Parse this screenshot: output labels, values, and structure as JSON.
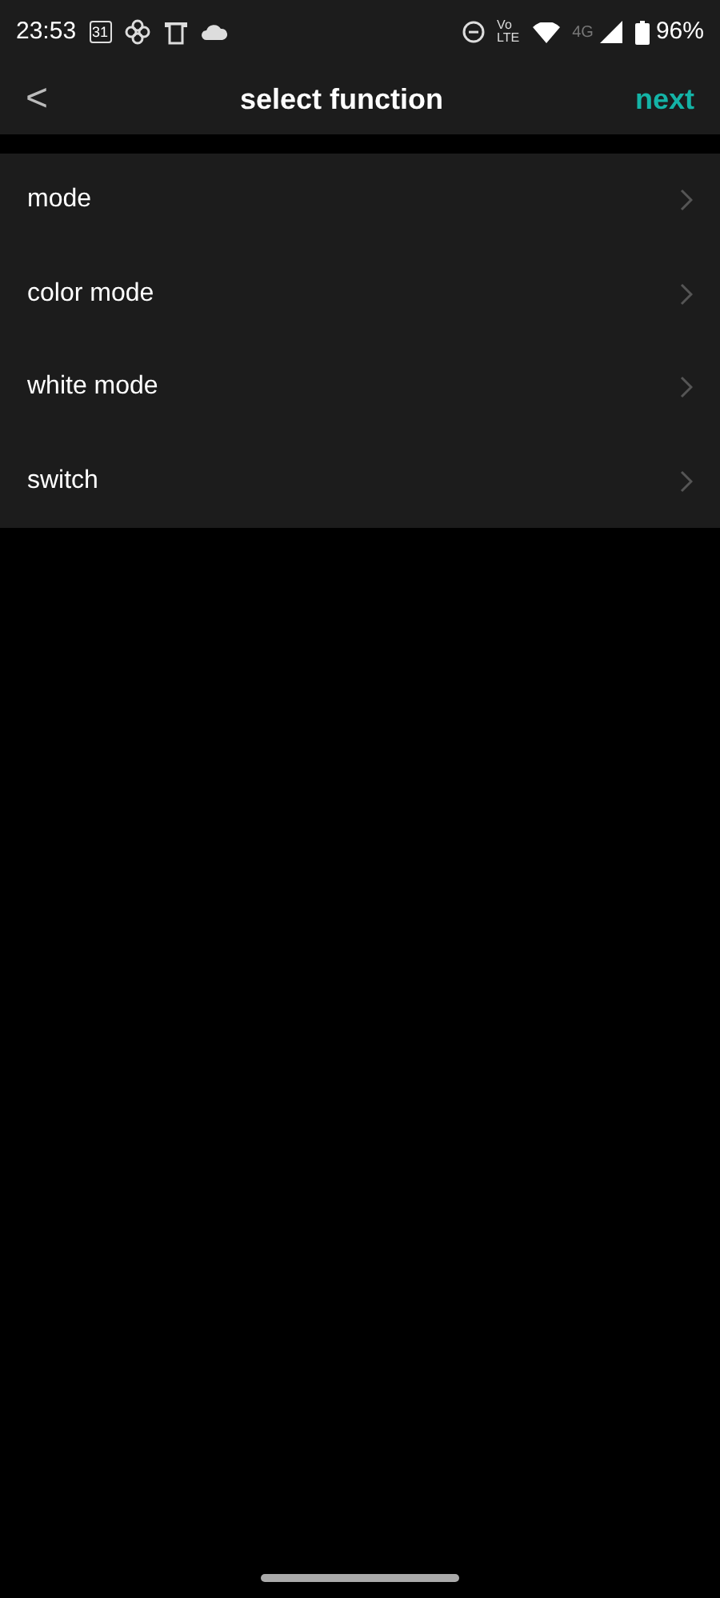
{
  "status_bar": {
    "time": "23:53",
    "calendar_day": "31",
    "volte": [
      "Vo",
      "LTE"
    ],
    "network": "4G",
    "battery": "96%"
  },
  "header": {
    "back": "<",
    "title": "select function",
    "action": "next"
  },
  "functions": [
    {
      "label": "mode"
    },
    {
      "label": "color mode"
    },
    {
      "label": "white mode"
    },
    {
      "label": "switch"
    }
  ]
}
